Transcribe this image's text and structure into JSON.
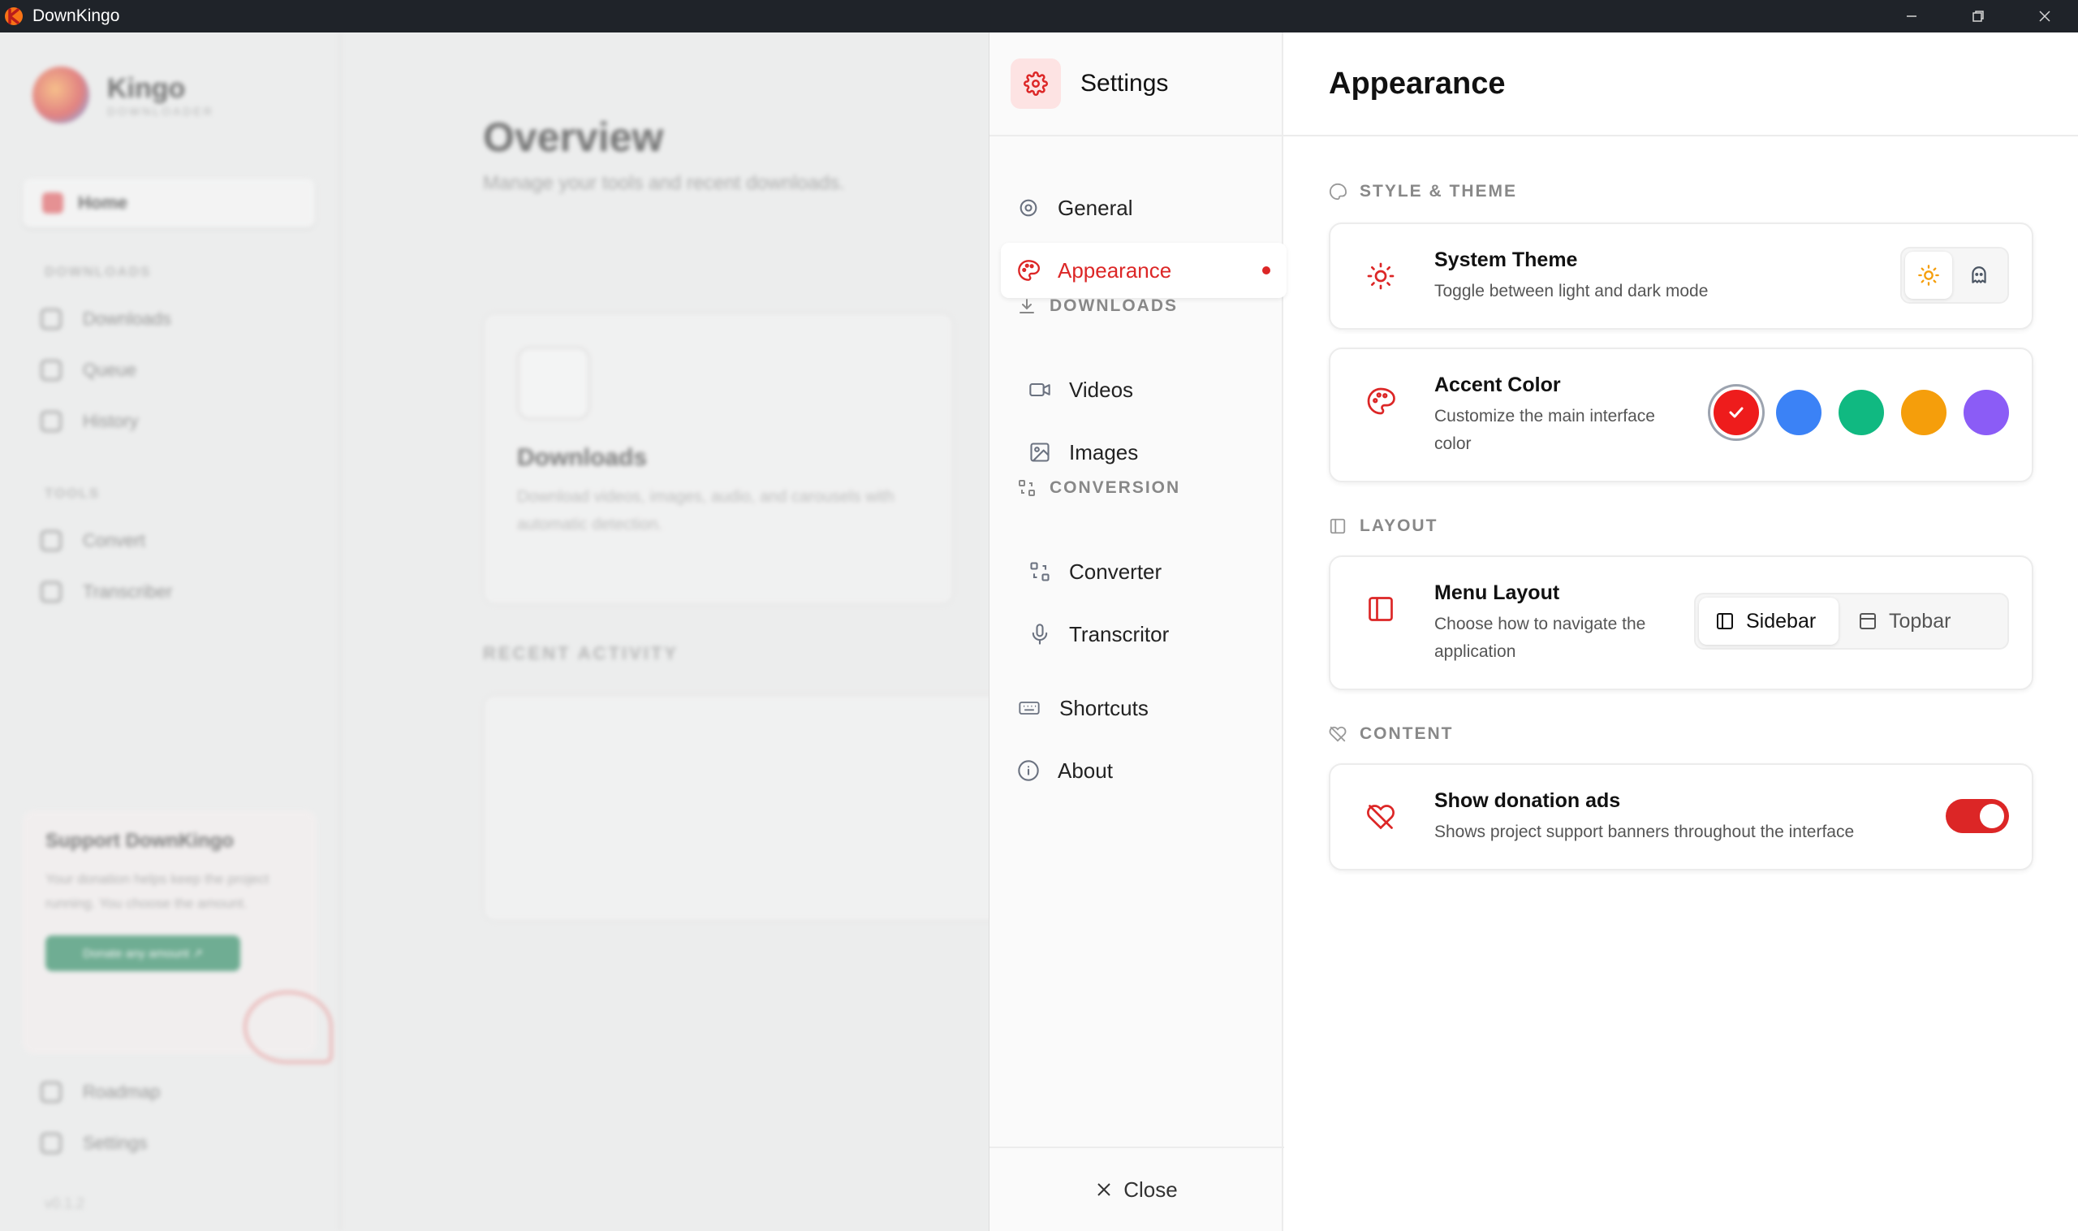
{
  "window": {
    "title": "DownKingo"
  },
  "background": {
    "logo_name": "Kingo",
    "logo_sub": "DOWNLOADER",
    "home_label": "Home",
    "downloads_section": "DOWNLOADS",
    "downloads_items": [
      "Downloads",
      "Queue",
      "History"
    ],
    "tools_section": "TOOLS",
    "tools_items": [
      "Convert",
      "Transcriber"
    ],
    "support_title": "Support DownKingo",
    "support_text": "Your donation helps keep the project running. You choose the amount.",
    "donate_button": "Donate any amount ↗",
    "bottom_items": [
      "Roadmap",
      "Settings"
    ],
    "version": "v0.1.2",
    "page_title": "Overview",
    "page_subtitle": "Manage your tools and recent downloads.",
    "card_title": "Downloads",
    "card_text": "Download videos, images, audio, and carousels with automatic detection.",
    "recent_activity": "RECENT ACTIVITY"
  },
  "settings": {
    "title": "Settings",
    "nav": {
      "general": "General",
      "appearance": "Appearance",
      "downloads_section": "DOWNLOADS",
      "videos": "Videos",
      "images": "Images",
      "conversion_section": "CONVERSION",
      "converter": "Converter",
      "transcriptor": "Transcritor",
      "shortcuts": "Shortcuts",
      "about": "About"
    },
    "close_label": "Close",
    "content": {
      "header": "Appearance",
      "style_section": "STYLE & THEME",
      "system_theme": {
        "title": "System Theme",
        "desc": "Toggle between light and dark mode",
        "selected": "light"
      },
      "accent_color": {
        "title": "Accent Color",
        "desc": "Customize the main interface color",
        "colors": [
          "#ee1c1c",
          "#3b82f6",
          "#10b981",
          "#f59e0b",
          "#8b5cf6"
        ],
        "selected_index": 0
      },
      "layout_section": "LAYOUT",
      "menu_layout": {
        "title": "Menu Layout",
        "desc": "Choose how to navigate the application",
        "options": [
          "Sidebar",
          "Topbar"
        ],
        "selected": "Sidebar"
      },
      "content_section": "CONTENT",
      "donation_ads": {
        "title": "Show donation ads",
        "desc": "Shows project support banners throughout the interface",
        "enabled": true
      }
    }
  },
  "colors": {
    "accent": "#dc2626",
    "titlebar": "#1f2329"
  }
}
